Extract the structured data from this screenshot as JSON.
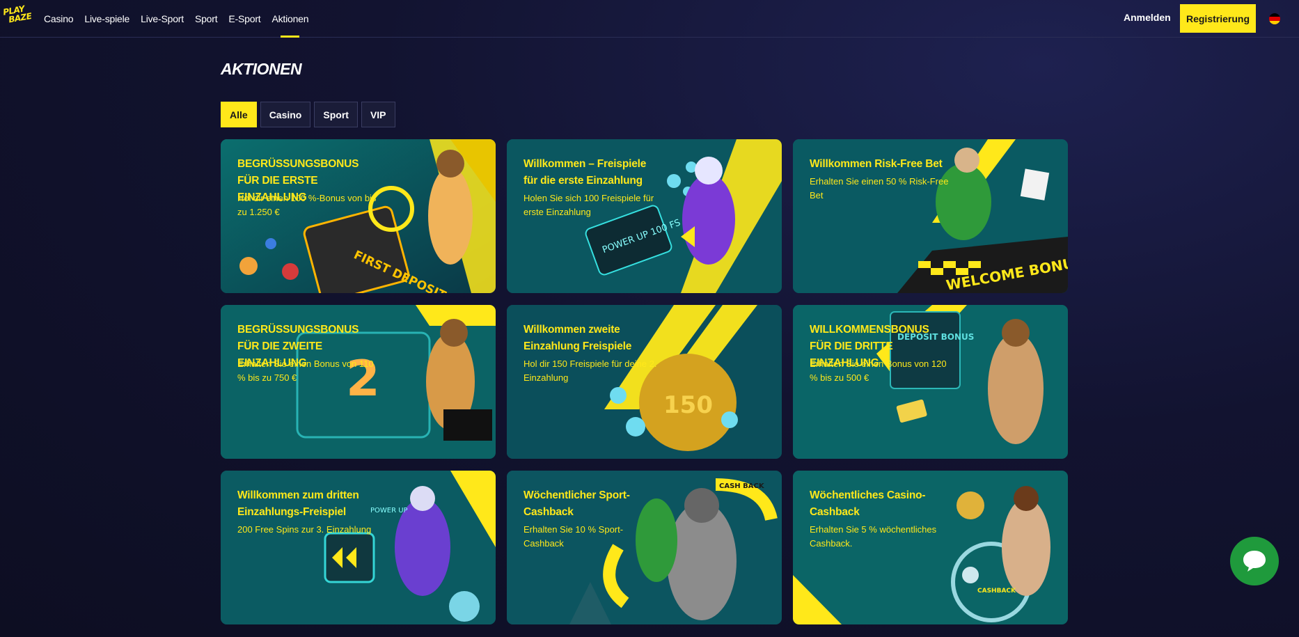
{
  "brand": {
    "logo_line1": "PLAY",
    "logo_line2": "BAZE",
    "accent": "#ffe81a"
  },
  "nav": {
    "items": [
      {
        "label": "Casino"
      },
      {
        "label": "Live-spiele"
      },
      {
        "label": "Live-Sport"
      },
      {
        "label": "Sport"
      },
      {
        "label": "E-Sport"
      },
      {
        "label": "Aktionen",
        "active": true
      }
    ],
    "login_label": "Anmelden",
    "register_label": "Registrierung",
    "language_icon": "german-flag-icon"
  },
  "page": {
    "title": "AKTIONEN",
    "filters": [
      {
        "label": "Alle",
        "active": true
      },
      {
        "label": "Casino"
      },
      {
        "label": "Sport"
      },
      {
        "label": "VIP"
      }
    ]
  },
  "promotions": [
    {
      "title": "BEGRÜSSUNGSBONUS FÜR DIE ERSTE EINZAHLUNG",
      "description": "Hol dir einen 100 %-Bonus von bis zu 1.250 €",
      "art_text": "FIRST DEPOSIT BONUS"
    },
    {
      "title": "Willkommen – Freispiele für die erste Einzahlung",
      "description": "Holen Sie sich 100 Freispiele für erste Einzahlung",
      "art_text": "POWER UP 100 FS"
    },
    {
      "title": "Willkommen Risk-Free Bet",
      "description": "Erhalten Sie einen 50 % Risk-Free Bet",
      "art_text": "WELCOME BONUS"
    },
    {
      "title": "BEGRÜSSUNGSBONUS FÜR DIE ZWEITE EINZAHLUNG",
      "description": "Erhalten Sie einen Bonus von 110 % bis zu 750 €",
      "art_text": "2"
    },
    {
      "title": "Willkommen zweite Einzahlung Freispiele",
      "description": "Hol dir 150 Freispiele für deine 2. Einzahlung",
      "art_text": "150"
    },
    {
      "title": "WILLKOMMENSBONUS FÜR DIE DRITTE EINZAHLUNG",
      "description": "Erhalten Sie einen Bonus von 120 % bis zu 500 €",
      "art_text": "DEPOSIT BONUS"
    },
    {
      "title": "Willkommen zum dritten Einzahlungs-Freispiel",
      "description": "200 Free Spins zur 3. Einzahlung",
      "art_text": "POWER UP"
    },
    {
      "title": "Wöchentlicher Sport-Cashback",
      "description": "Erhalten Sie 10 % Sport-Cashback",
      "art_text": "CASH BACK"
    },
    {
      "title": "Wöchentliches Casino-Cashback",
      "description": "Erhalten Sie 5 % wöchentliches Cashback.",
      "art_text": "CASHBACK"
    }
  ],
  "chat": {
    "icon": "chat-bubble-icon",
    "color": "#1f9a3c"
  }
}
